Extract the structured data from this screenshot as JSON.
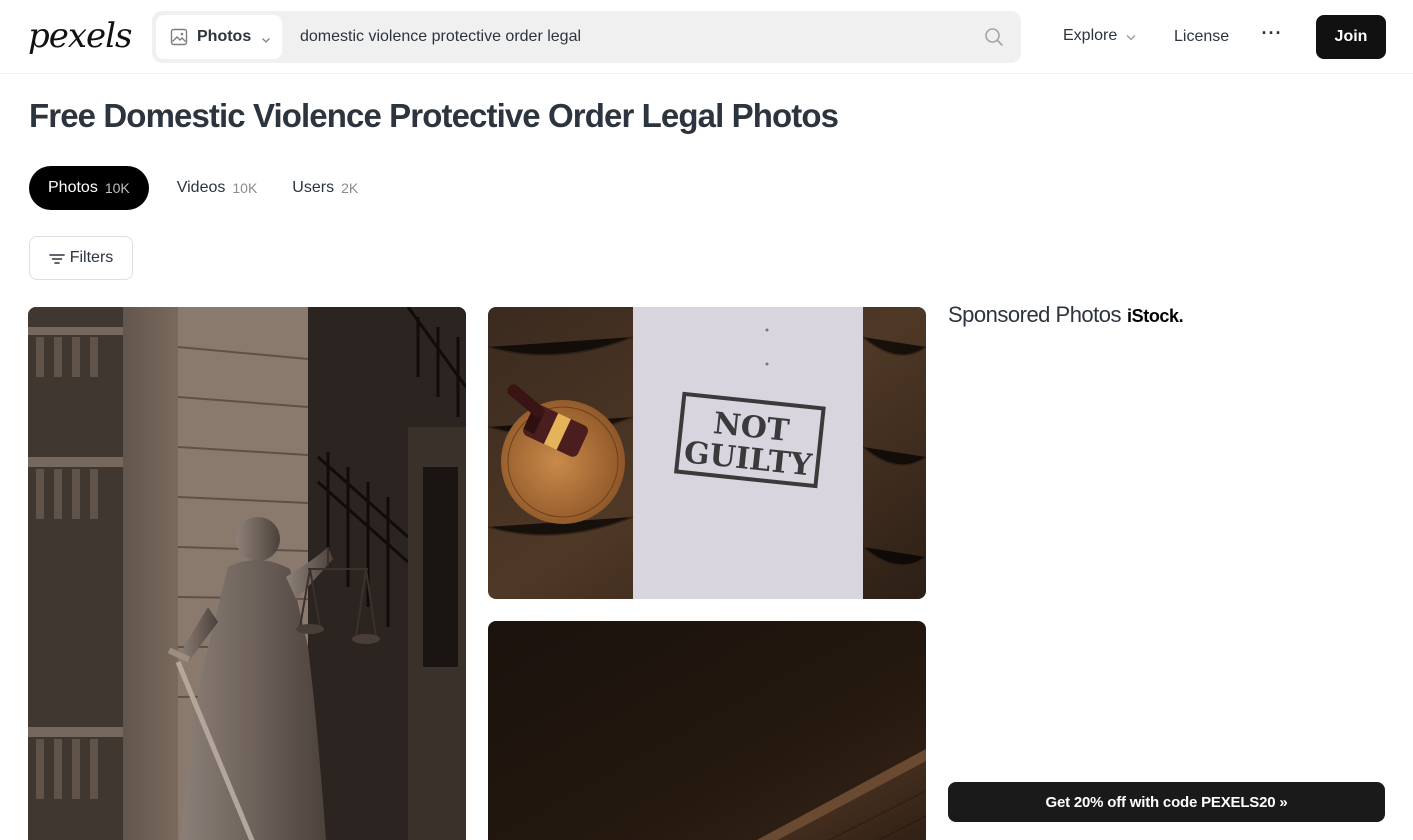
{
  "header": {
    "logo": "pexels",
    "search": {
      "scope_label": "Photos",
      "query": "domestic violence protective order legal"
    },
    "nav": {
      "explore": "Explore",
      "license": "License",
      "more": "···",
      "join": "Join"
    }
  },
  "page": {
    "title": "Free Domestic Violence Protective Order Legal Photos"
  },
  "tabs": [
    {
      "label": "Photos",
      "count": "10K",
      "active": true
    },
    {
      "label": "Videos",
      "count": "10K",
      "active": false
    },
    {
      "label": "Users",
      "count": "2K",
      "active": false
    }
  ],
  "filters": {
    "label": "Filters"
  },
  "photos": [
    {
      "name": "lady-justice-statue-photo"
    },
    {
      "name": "not-guilty-gavel-photo",
      "stamp_line_1": "NOT",
      "stamp_line_2": "GUILTY"
    },
    {
      "name": "dark-wood-photo"
    }
  ],
  "sponsored": {
    "title": "Sponsored Photos",
    "brand": "iStock.",
    "promo": "Get 20% off with code PEXELS20 »"
  },
  "colors": {
    "accent_dark": "#111111",
    "search_bg": "#f0f0f1",
    "text": "#2c343e",
    "muted": "#8b8b8b"
  },
  "icons": [
    "image-icon",
    "chevron-down-icon",
    "search-icon",
    "filter-icon"
  ]
}
